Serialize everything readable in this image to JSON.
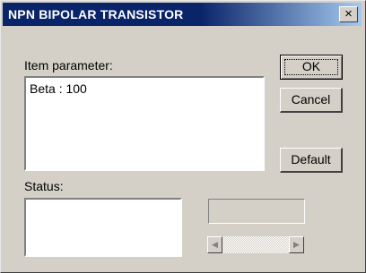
{
  "window": {
    "title": "NPN BIPOLAR TRANSISTOR",
    "close_glyph": "×"
  },
  "item_parameter": {
    "label": "Item parameter:",
    "value": "Beta : 100"
  },
  "status": {
    "label": "Status:"
  },
  "buttons": {
    "ok": "OK",
    "cancel": "Cancel",
    "default": "Default"
  },
  "scrollbar": {
    "left_arrow": "◀",
    "right_arrow": "▶"
  },
  "icons": {
    "close": "close-icon",
    "left": "arrow-left-icon",
    "right": "arrow-right-icon"
  },
  "colors": {
    "titlebar_start": "#0a246a",
    "titlebar_end": "#a6caf0",
    "face": "#d4d0c8"
  }
}
